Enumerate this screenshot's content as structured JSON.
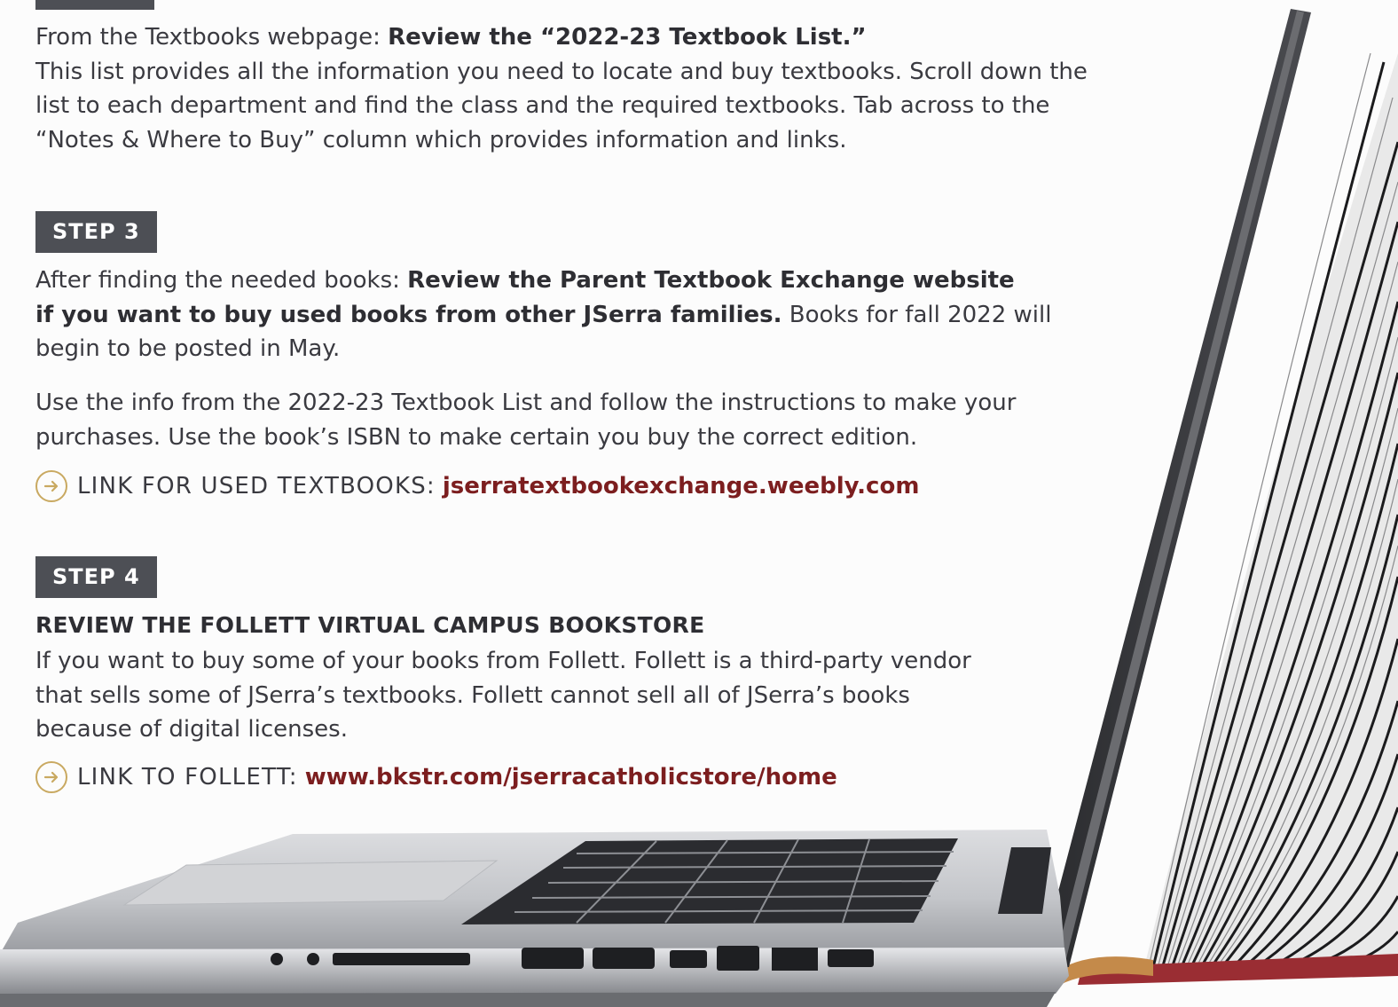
{
  "step2": {
    "intro": "From the Textbooks webpage: ",
    "intro_bold": "Review the “2022-23 Textbook List.”",
    "line1": "This list provides all the information you need to locate and buy textbooks. Scroll down the",
    "line2": "list to each department and find the class and the required textbooks. Tab across to the",
    "line3": "“Notes & Where to Buy” column which provides information and links."
  },
  "step3": {
    "badge": "STEP 3",
    "p1_intro": "After finding the needed books: ",
    "p1_bold_a": "Review the Parent Textbook Exchange website",
    "p1_bold_b": "if you want to buy used books from other JSerra families.",
    "p1_tail": " Books for fall 2022 will",
    "p1_line3": "begin to be posted in May.",
    "p2_line1": "Use the info from the 2022-23 Textbook List and follow the instructions to make your",
    "p2_line2": "purchases. Use the book’s ISBN to make certain you buy the correct edition.",
    "link_label": "LINK FOR USED TEXTBOOKS:",
    "link_url": "jserratextbookexchange.weebly.com"
  },
  "step4": {
    "badge": "STEP 4",
    "heading": "REVIEW THE FOLLETT VIRTUAL CAMPUS BOOKSTORE",
    "line1": "If you want to buy some of your books from Follett. Follett is a third-party vendor",
    "line2": "that sells some of JSerra’s textbooks. Follett cannot sell all of JSerra’s books",
    "line3": "because of digital licenses.",
    "link_label": "LINK TO FOLLETT:",
    "link_url": "www.bkstr.com/jserracatholicstore/home"
  },
  "colors": {
    "badge_bg": "#4d4f55",
    "link_red": "#7c1e1f",
    "arrow_gold": "#c9a961",
    "text": "#3a3a40"
  },
  "icons": [
    "arrow-right-circle-icon",
    "laptop-book-illustration"
  ]
}
